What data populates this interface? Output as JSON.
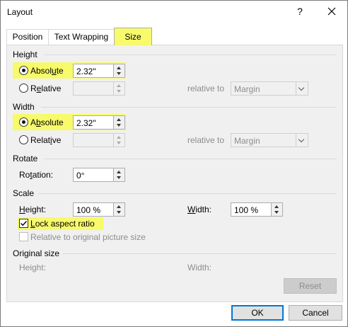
{
  "window": {
    "title": "Layout",
    "help_label": "?"
  },
  "tabs": [
    {
      "label": "Position"
    },
    {
      "label": "Text Wrapping"
    },
    {
      "label": "Size"
    }
  ],
  "height_section": {
    "title": "Height",
    "absolute_label_pre": "Absol",
    "absolute_label_ul": "u",
    "absolute_label_post": "te",
    "absolute_value": "2.32\"",
    "relative_label_pre": "R",
    "relative_label_ul": "e",
    "relative_label_post": "lative",
    "relative_value": "",
    "relative_to_label": "relative to",
    "relative_to_value": "Margin"
  },
  "width_section": {
    "title": "Width",
    "absolute_label_pre": "A",
    "absolute_label_ul": "b",
    "absolute_label_post": "solute",
    "absolute_value": "2.32\"",
    "relative_label_pre": "Relat",
    "relative_label_ul": "i",
    "relative_label_post": "ve",
    "relative_value": "",
    "relative_to_label": "relative to",
    "relative_to_value": "Margin"
  },
  "rotate_section": {
    "title": "Rotate",
    "rotation_label_pre": "Ro",
    "rotation_label_ul": "t",
    "rotation_label_post": "ation:",
    "rotation_value": "0°"
  },
  "scale_section": {
    "title": "Scale",
    "height_label_pre": "",
    "height_label_ul": "H",
    "height_label_post": "eight:",
    "height_value": "100 %",
    "width_label_pre": "",
    "width_label_ul": "W",
    "width_label_post": "idth:",
    "width_value": "100 %",
    "lock_label_pre": "",
    "lock_label_ul": "L",
    "lock_label_post": "ock aspect ratio",
    "lock_checked": true,
    "relative_original_label": "Relative to original picture size",
    "relative_original_checked": false
  },
  "original_size": {
    "title": "Original size",
    "height_label": "Height:",
    "width_label": "Width:"
  },
  "buttons": {
    "reset": "Reset",
    "ok": "OK",
    "cancel": "Cancel"
  },
  "colors": {
    "highlight": "#f7fa6b",
    "ok_border": "#0078d7"
  }
}
